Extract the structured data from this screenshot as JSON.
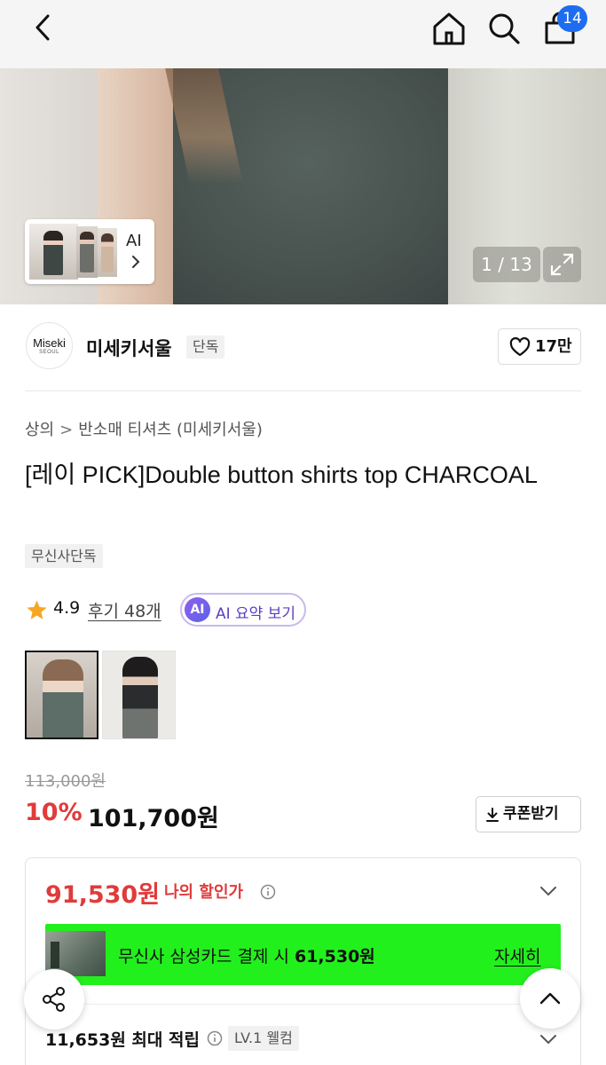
{
  "header": {
    "cart_count": "14"
  },
  "hero": {
    "ai_label": "AI",
    "counter": "1 / 13"
  },
  "brand": {
    "logo_text": "Miseki",
    "logo_sub": "SEOUL",
    "name": "미세키서울",
    "tag": "단독",
    "likes": "17만"
  },
  "breadcrumb": {
    "category": "상의",
    "separator": ">",
    "subcategory": "반소매 티셔츠 (미세키서울)"
  },
  "product": {
    "title": "[레이 PICK]Double button shirts top CHARCOAL",
    "badge": "무신사단독"
  },
  "rating": {
    "score": "4.9",
    "reviews": "후기 48개",
    "ai_badge": "AI",
    "ai_summary": "AI 요약 보기"
  },
  "price": {
    "original": "113,000원",
    "discount": "10%",
    "final": "101,700원",
    "coupon": "쿠폰받기"
  },
  "benefit": {
    "my_price": "91,530원",
    "my_label": "나의 할인가",
    "promo_text": "무신사 삼성카드 결제 시",
    "promo_price": "61,530원",
    "promo_more": "자세히",
    "points": "11,653원 최대 적립",
    "level": "LV.1 웰컴"
  },
  "colors": {
    "cart_badge": "#1e6cf0",
    "discount": "#e03b3b",
    "promo_bg": "#22f01d",
    "ai_purple": "#5b3fbf"
  }
}
